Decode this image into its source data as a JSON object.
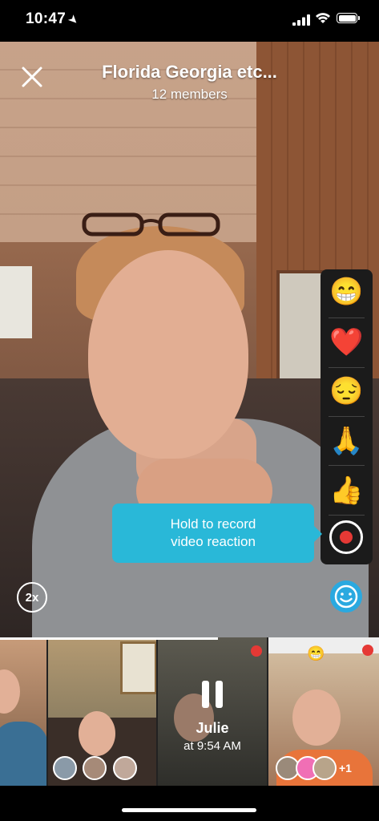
{
  "status_bar": {
    "time": "10:47"
  },
  "header": {
    "title": "Florida Georgia etc...",
    "subtitle": "12 members"
  },
  "reactions": {
    "items": [
      "😁",
      "❤️",
      "😔",
      "🙏",
      "👍"
    ],
    "record_icon": "record-icon"
  },
  "tooltip": {
    "line1": "Hold to record",
    "line2": "video reaction"
  },
  "controls": {
    "speed_label": "2x",
    "emoji_icon": "smile-icon"
  },
  "thumb_strip": {
    "active_viewer": {
      "name": "Julie",
      "time": "at 9:54 AM"
    },
    "small_emoji": "😁",
    "plus_count": "+1"
  }
}
